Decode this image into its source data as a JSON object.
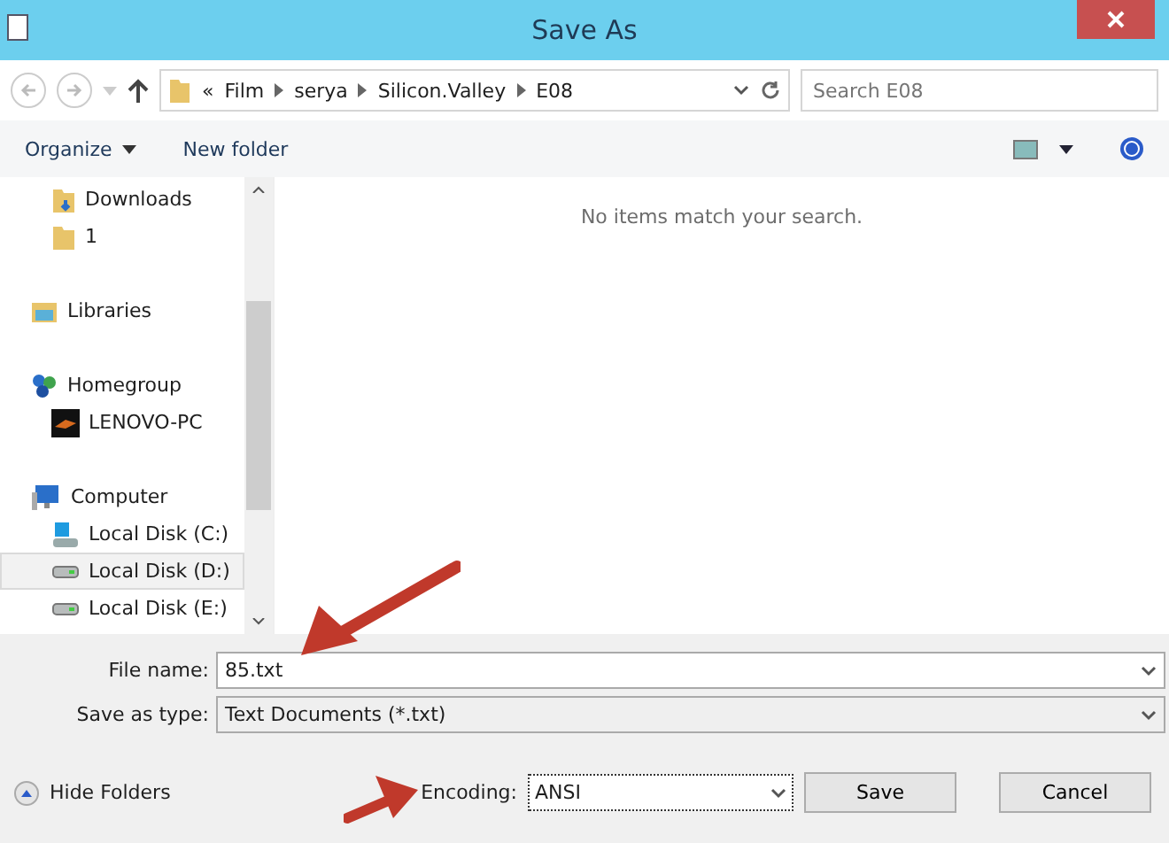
{
  "window": {
    "title": "Save As"
  },
  "address": {
    "overflow": "«",
    "crumbs": [
      "Film",
      "serya",
      "Silicon.Valley",
      "E08"
    ]
  },
  "search": {
    "placeholder": "Search E08"
  },
  "toolbar": {
    "organize": "Organize",
    "new_folder": "New folder"
  },
  "sidebar": {
    "continued": [
      {
        "label": "Downloads",
        "kind": "downloads",
        "selected": false
      },
      {
        "label": "1",
        "kind": "folder",
        "selected": false
      }
    ],
    "groups": [
      {
        "label": "Libraries",
        "kind": "libraries",
        "selected": false
      },
      {
        "label": "Homegroup",
        "kind": "homegroup",
        "selected": false,
        "children": [
          {
            "label": "LENOVO-PC",
            "kind": "user",
            "selected": false
          }
        ]
      },
      {
        "label": "Computer",
        "kind": "computer",
        "selected": false,
        "children": [
          {
            "label": "Local Disk (C:)",
            "kind": "system-disk",
            "selected": false
          },
          {
            "label": "Local Disk (D:)",
            "kind": "disk",
            "selected": true
          },
          {
            "label": "Local Disk (E:)",
            "kind": "disk",
            "selected": false
          }
        ]
      }
    ]
  },
  "content": {
    "empty_message": "No items match your search."
  },
  "form": {
    "file_name_label": "File name:",
    "file_name": "85.txt",
    "type_label": "Save as type:",
    "type": "Text Documents (*.txt)"
  },
  "footer": {
    "hide_folders": "Hide Folders",
    "encoding_label": "Encoding:",
    "encoding": "ANSI",
    "save": "Save",
    "cancel": "Cancel"
  }
}
